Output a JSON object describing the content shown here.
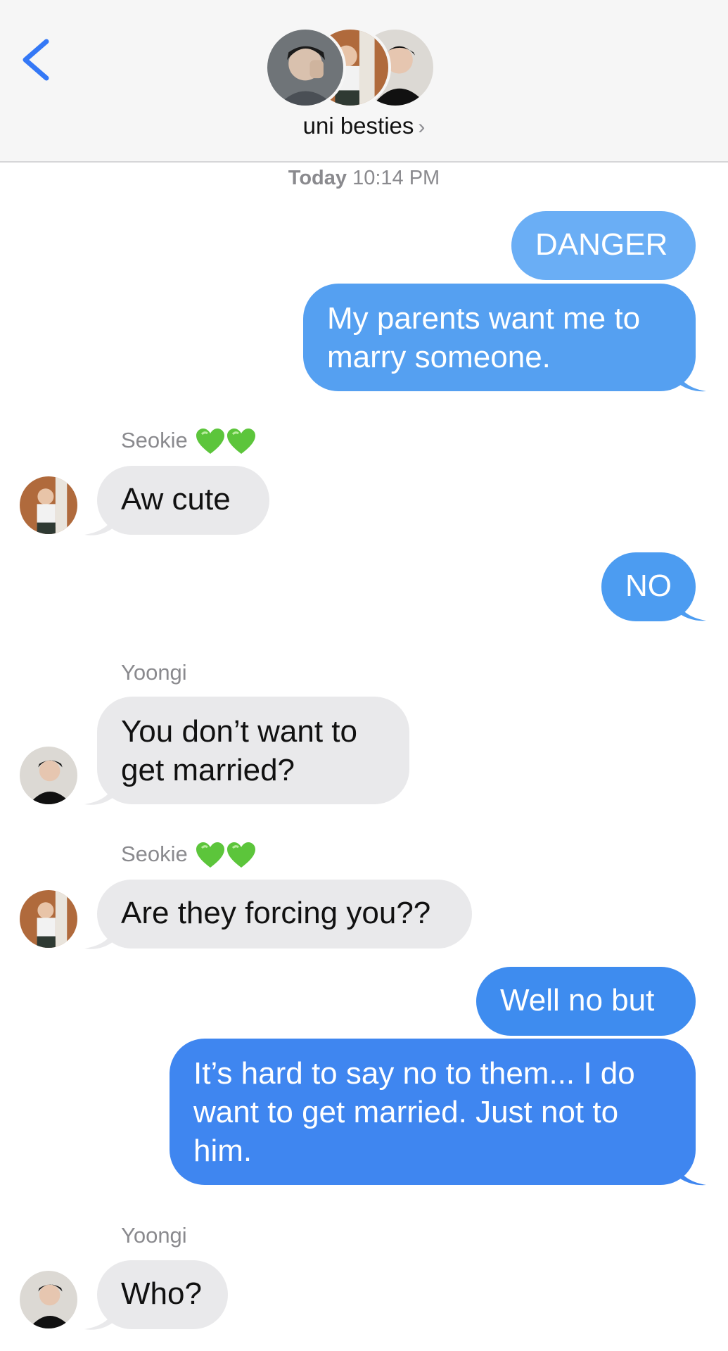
{
  "header": {
    "group_name": "uni besties",
    "chevron": "›",
    "back_icon": "chevron-left-icon",
    "accent": "#3478f6"
  },
  "timestamp": {
    "day": "Today",
    "time": "10:14 PM"
  },
  "colors": {
    "outgoing_bubble": "#4a9bef",
    "outgoing_bubble_dark": "#3f86f0",
    "incoming_bubble": "#e9e9eb"
  },
  "messages": [
    {
      "direction": "out",
      "text": "DANGER"
    },
    {
      "direction": "out",
      "lines": [
        "My parents want me to",
        "marry someone."
      ]
    },
    {
      "direction": "in",
      "sender": "Seokie",
      "sender_emoji": "green-heart-icon",
      "text": "Aw cute"
    },
    {
      "direction": "out",
      "text": "NO"
    },
    {
      "direction": "in",
      "sender": "Yoongi",
      "lines": [
        "You don’t want to",
        "get married?"
      ]
    },
    {
      "direction": "in",
      "sender": "Seokie",
      "sender_emoji": "green-heart-icon",
      "text": "Are they forcing you??"
    },
    {
      "direction": "out",
      "text": "Well no but"
    },
    {
      "direction": "out",
      "lines": [
        "It’s hard to say no to them... I do",
        "want to get married. Just not to",
        "him."
      ]
    },
    {
      "direction": "in",
      "sender": "Yoongi",
      "text": "Who?"
    }
  ]
}
